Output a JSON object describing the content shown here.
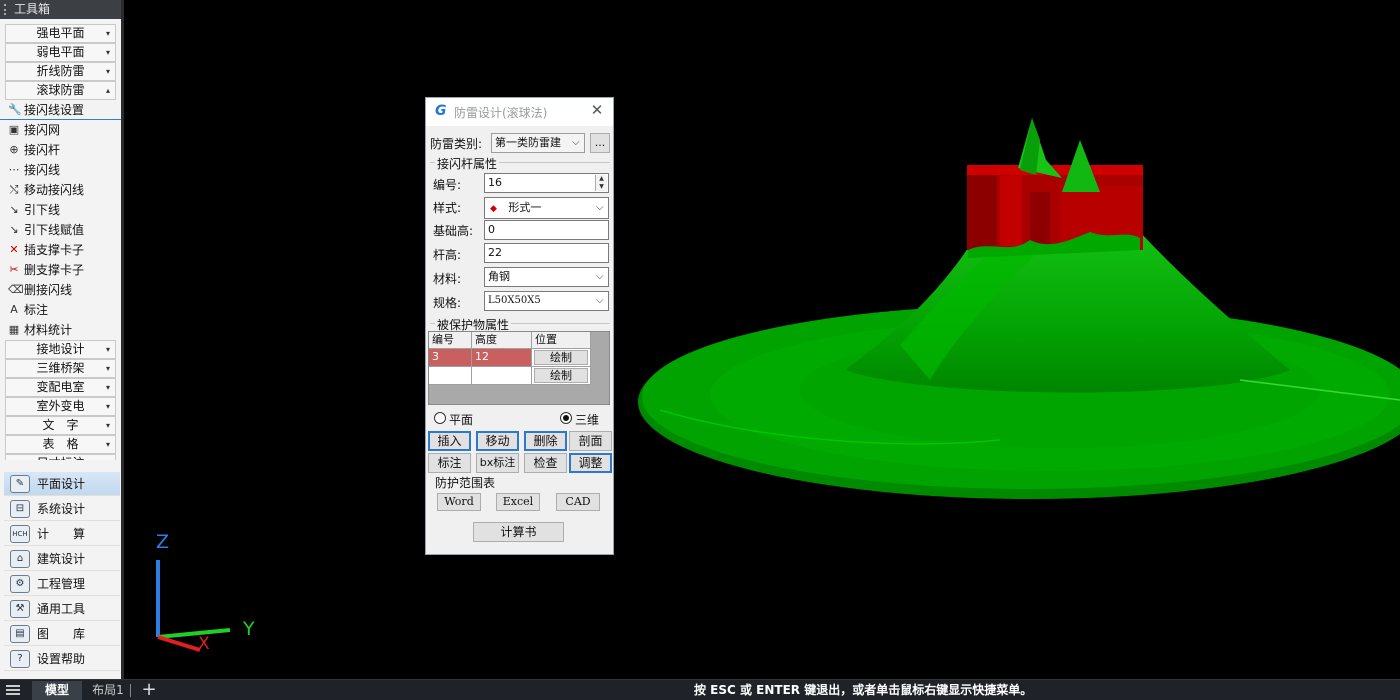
{
  "toolbox": {
    "title": "工具箱",
    "categories_top": [
      {
        "label": "强电平面",
        "arrow": "▾"
      },
      {
        "label": "弱电平面",
        "arrow": "▾"
      },
      {
        "label": "折线防雷",
        "arrow": "▾"
      },
      {
        "label": "滚球防雷",
        "arrow": "▴"
      }
    ],
    "items": [
      {
        "label": "接闪线设置",
        "icon": "wrench-icon",
        "glyph": "🔧"
      },
      {
        "label": "接闪网",
        "icon": "mesh-icon",
        "glyph": "▣"
      },
      {
        "label": "接闪杆",
        "icon": "rod-icon",
        "glyph": "⊕"
      },
      {
        "label": "接闪线",
        "icon": "line-icon",
        "glyph": "⋯"
      },
      {
        "label": "移动接闪线",
        "icon": "move-line-icon",
        "glyph": "⤭"
      },
      {
        "label": "引下线",
        "icon": "downlead-icon",
        "glyph": "↘"
      },
      {
        "label": "引下线赋值",
        "icon": "downlead-assign-icon",
        "glyph": "↘"
      },
      {
        "label": "插支撑卡子",
        "icon": "insert-clip-icon",
        "glyph": "✕"
      },
      {
        "label": "删支撑卡子",
        "icon": "delete-clip-icon",
        "glyph": "✂"
      },
      {
        "label": "删接闪线",
        "icon": "delete-line-icon",
        "glyph": "⌫"
      },
      {
        "label": "标注",
        "icon": "annotate-icon",
        "glyph": "A"
      },
      {
        "label": "材料统计",
        "icon": "table-icon",
        "glyph": "▦"
      }
    ],
    "categories_bottom": [
      {
        "label": "接地设计",
        "arrow": "▾"
      },
      {
        "label": "三维桥架",
        "arrow": "▾"
      },
      {
        "label": "变配电室",
        "arrow": "▾"
      },
      {
        "label": "室外变电",
        "arrow": "▾"
      },
      {
        "label": "文　字",
        "arrow": "▾"
      },
      {
        "label": "表　格",
        "arrow": "▾"
      },
      {
        "label": "尺寸标注",
        "arrow": "▾"
      }
    ],
    "big_buttons": [
      {
        "label": "平面设计",
        "icon": "plan-design-icon",
        "glyph": "✎",
        "active": true
      },
      {
        "label": "系统设计",
        "icon": "system-design-icon",
        "glyph": "⊟",
        "active": false
      },
      {
        "label": "计　　算",
        "icon": "calc-icon",
        "glyph": "HCH",
        "active": false
      },
      {
        "label": "建筑设计",
        "icon": "building-icon",
        "glyph": "⌂",
        "active": false
      },
      {
        "label": "工程管理",
        "icon": "project-icon",
        "glyph": "⚙",
        "active": false
      },
      {
        "label": "通用工具",
        "icon": "tools-icon",
        "glyph": "⚒",
        "active": false
      },
      {
        "label": "图　　库",
        "icon": "library-icon",
        "glyph": "▤",
        "active": false
      },
      {
        "label": "设置帮助",
        "icon": "help-icon",
        "glyph": "?",
        "active": false
      }
    ]
  },
  "dialog": {
    "title": "防雷设计(滚球法)",
    "category_label": "防雷类别:",
    "category_value": "第一类防雷建",
    "more_button": "...",
    "rod_group": "接闪杆属性",
    "fields": {
      "number": {
        "label": "编号:",
        "value": "16"
      },
      "style": {
        "label": "样式:",
        "value": "形式一",
        "marker": "◆"
      },
      "base_height": {
        "label": "基础高:",
        "value": "0"
      },
      "rod_height": {
        "label": "杆高:",
        "value": "22"
      },
      "material": {
        "label": "材料:",
        "value": "角钢"
      },
      "spec": {
        "label": "规格:",
        "value": "L50X50X5"
      }
    },
    "protected_group": "被保护物属性",
    "table": {
      "headers": [
        "编号",
        "高度",
        "位置"
      ],
      "rows": [
        {
          "number": "3",
          "height": "12",
          "action": "绘制"
        },
        {
          "number": "",
          "height": "",
          "action": "绘制"
        }
      ]
    },
    "view_mode": {
      "plane": "平面",
      "three_d": "三维",
      "selected": "three_d"
    },
    "buttons_row1": [
      "插入",
      "移动",
      "删除",
      "剖面"
    ],
    "buttons_row2": [
      "标注",
      "bx标注",
      "检查",
      "调整"
    ],
    "range_group": "防护范围表",
    "export_buttons": [
      "Word",
      "Excel",
      "CAD"
    ],
    "calc_book": "计算书"
  },
  "axes": {
    "z": "Z",
    "y": "Y",
    "x": "X"
  },
  "statusbar": {
    "tab_model": "模型",
    "tab_layout": "布局1",
    "add_tab": "+",
    "prompt": "按 ESC 或 ENTER 键退出，或者单击鼠标右键显示快捷菜单。"
  },
  "colors": {
    "cone_green": "#00a400",
    "building_red": "#b30000",
    "axis_z": "#2f7ee8",
    "axis_y": "#20d020",
    "axis_x": "#e02020",
    "accent": "#2d78c8"
  }
}
